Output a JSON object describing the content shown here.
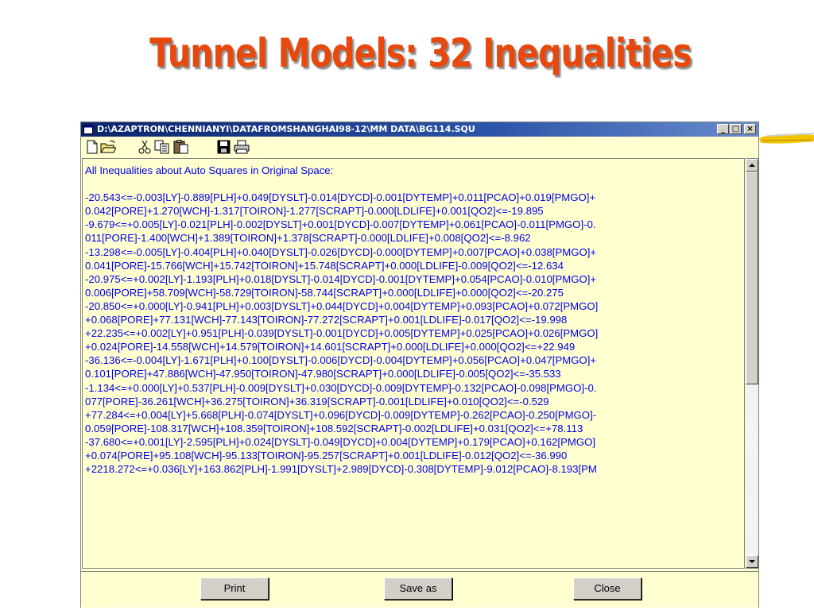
{
  "slide": {
    "title": "Tunnel Models:  32 Inequalities"
  },
  "window": {
    "title": "D:\\AZAPTRON\\CHENNIANYI\\DATAFROMSHANGHAI98-12\\MM DATA\\BG114.SQU",
    "controls": {
      "minimize": "_",
      "maximize": "□",
      "close": "×"
    }
  },
  "toolbar": {
    "icons": [
      "new-icon",
      "open-icon",
      "cut-icon",
      "copy-icon",
      "paste-icon",
      "save-icon",
      "print-icon"
    ]
  },
  "content": {
    "lines": [
      "All Inequalities about Auto Squares in Original Space:",
      "",
      "-20.543<=-0.003[LY]-0.889[PLH]+0.049[DYSLT]-0.014[DYCD]-0.001[DYTEMP]+0.011[PCAO]+0.019[PMGO]+",
      "0.042[PORE]+1.270[WCH]-1.317[TOIRON]-1.277[SCRAPT]-0.000[LDLIFE]+0.001[QO2]<=-19.895",
      "-9.679<=+0.005[LY]-0.021[PLH]-0.002[DYSLT]+0.001[DYCD]-0.007[DYTEMP]+0.061[PCAO]-0.011[PMGO]-0.",
      "011[PORE]-1.400[WCH]+1.389[TOIRON]+1.378[SCRAPT]-0.000[LDLIFE]+0.008[QO2]<=-8.962",
      "-13.298<=-0.005[LY]-0.404[PLH]+0.040[DYSLT]-0.026[DYCD]-0.000[DYTEMP]+0.007[PCAO]+0.038[PMGO]+",
      "0.041[PORE]-15.766[WCH]+15.742[TOIRON]+15.748[SCRAPT]+0.000[LDLIFE]-0.009[QO2]<=-12.634",
      "-20.975<=+0.002[LY]-1.193[PLH]+0.018[DYSLT]-0.014[DYCD]-0.001[DYTEMP]+0.054[PCAO]-0.010[PMGO]+",
      "0.006[PORE]+58.709[WCH]-58.729[TOIRON]-58.744[SCRAPT]+0.000[LDLIFE]+0.000[QO2]<=-20.275",
      "-20.850<=+0.000[LY]-0.941[PLH]+0.003[DYSLT]+0.044[DYCD]+0.004[DYTEMP]+0.093[PCAO]+0.072[PMGO]",
      "+0.068[PORE]+77.131[WCH]-77.143[TOIRON]-77.272[SCRAPT]+0.001[LDLIFE]-0.017[QO2]<=-19.998",
      "+22.235<=+0.002[LY]+0.951[PLH]-0.039[DYSLT]-0.001[DYCD]+0.005[DYTEMP]+0.025[PCAO]+0.026[PMGO]",
      "+0.024[PORE]-14.558[WCH]+14.579[TOIRON]+14.601[SCRAPT]+0.000[LDLIFE]+0.000[QO2]<=+22.949",
      "-36.136<=-0.004[LY]-1.671[PLH]+0.100[DYSLT]-0.006[DYCD]-0.004[DYTEMP]+0.056[PCAO]+0.047[PMGO]+",
      "0.101[PORE]+47.886[WCH]-47.950[TOIRON]-47.980[SCRAPT]+0.000[LDLIFE]-0.005[QO2]<=-35.533",
      "-1.134<=+0.000[LY]+0.537[PLH]-0.009[DYSLT]+0.030[DYCD]-0.009[DYTEMP]-0.132[PCAO]-0.098[PMGO]-0.",
      "077[PORE]-36.261[WCH]+36.275[TOIRON]+36.319[SCRAPT]-0.001[LDLIFE]+0.010[QO2]<=-0.529",
      "+77.284<=+0.004[LY]+5.668[PLH]-0.074[DYSLT]+0.096[DYCD]-0.009[DYTEMP]-0.262[PCAO]-0.250[PMGO]-",
      "0.059[PORE]-108.317[WCH]+108.359[TOIRON]+108.592[SCRAPT]-0.002[LDLIFE]+0.031[QO2]<=+78.113",
      "-37.680<=+0.001[LY]-2.595[PLH]+0.024[DYSLT]-0.049[DYCD]+0.004[DYTEMP]+0.179[PCAO]+0.162[PMGO]",
      "+0.074[PORE]+95.108[WCH]-95.133[TOIRON]-95.257[SCRAPT]+0.001[LDLIFE]-0.012[QO2]<=-36.990",
      "+2218.272<=+0.036[LY]+163.862[PLH]-1.991[DYSLT]+2.989[DYCD]-0.308[DYTEMP]-9.012[PCAO]-8.193[PM"
    ]
  },
  "buttons": {
    "print": "Print",
    "save_as": "Save as",
    "close": "Close"
  },
  "colors": {
    "title": "#e8480c",
    "text": "#0000f0",
    "window_bg": "#ffffd0",
    "titlebar": "#0a246a"
  }
}
